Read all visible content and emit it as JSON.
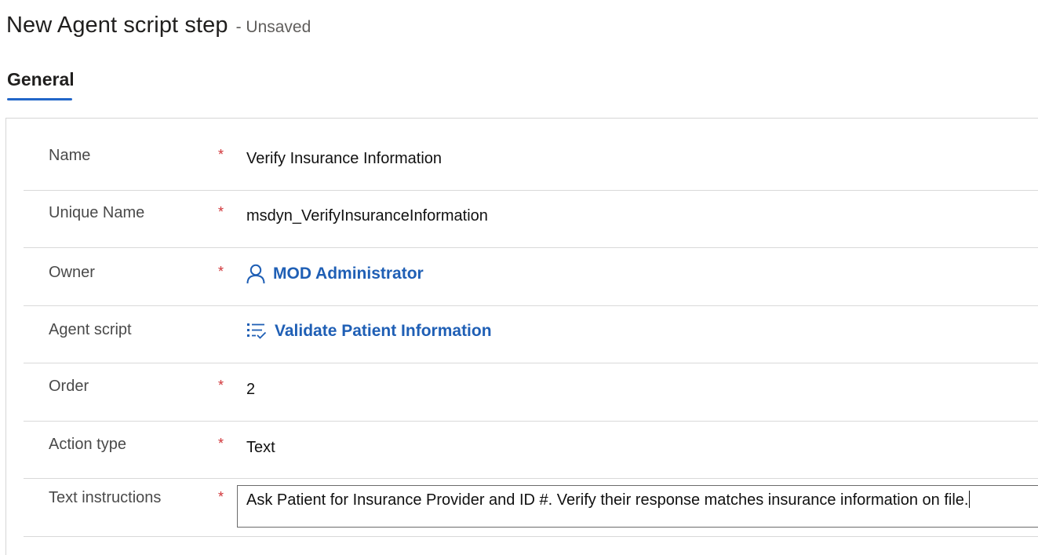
{
  "header": {
    "title": "New Agent script step",
    "status": "- Unsaved"
  },
  "tabs": [
    {
      "label": "General",
      "selected": true
    }
  ],
  "colors": {
    "accent": "#2266c8",
    "link": "#1f5fb5",
    "required": "#d13438"
  },
  "form": {
    "fields": [
      {
        "label": "Name",
        "required": true,
        "value": "Verify Insurance Information"
      },
      {
        "label": "Unique Name",
        "required": true,
        "value": "msdyn_VerifyInsuranceInformation"
      },
      {
        "label": "Owner",
        "required": true,
        "value": "MOD Administrator",
        "icon": "person-icon",
        "type": "lookup"
      },
      {
        "label": "Agent script",
        "required": false,
        "value": "Validate Patient Information",
        "icon": "checklist-icon",
        "type": "lookup"
      },
      {
        "label": "Order",
        "required": true,
        "value": "2"
      },
      {
        "label": "Action type",
        "required": true,
        "value": "Text"
      },
      {
        "label": "Text instructions",
        "required": true,
        "value": "Ask Patient for Insurance Provider and ID #. Verify their response matches insurance information on file.",
        "type": "textarea"
      }
    ],
    "required_marker": "*"
  }
}
